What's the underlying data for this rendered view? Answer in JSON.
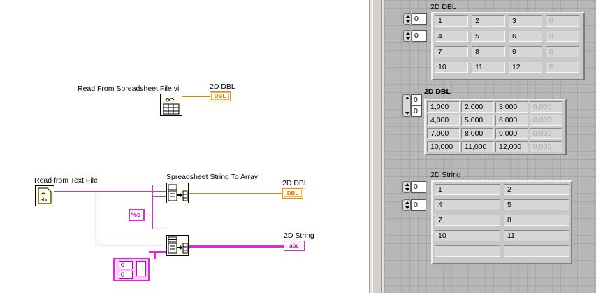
{
  "diagram": {
    "read_spreadsheet_label": "Read From Spreadsheet File.vi",
    "read_text_label": "Read from Text File",
    "spreadsheet_string_label": "Spreadsheet String To Array",
    "format_constant": "%s",
    "out_dbl_1_label": "2D DBL",
    "out_dbl_1_terminal": "DBL",
    "out_dbl_2_label": "2D DBL",
    "out_dbl_2_terminal": "DBL",
    "out_string_label": "2D String",
    "out_string_terminal": "abc",
    "read_text_icon": "abc",
    "array_constant": {
      "index_1": "0",
      "index_2": "0"
    }
  },
  "panel": {
    "arr1": {
      "label": "2D DBL",
      "index_row": "0",
      "index_col": "0",
      "rows": [
        [
          "1",
          "2",
          "3",
          "0"
        ],
        [
          "4",
          "5",
          "6",
          "0"
        ],
        [
          "7",
          "8",
          "9",
          "0"
        ],
        [
          "10",
          "11",
          "12",
          "0"
        ]
      ]
    },
    "arr2": {
      "label": "2D DBL",
      "index_row": "0",
      "index_col": "0",
      "rows": [
        [
          "1,000",
          "2,000",
          "3,000",
          "0,000"
        ],
        [
          "4,000",
          "5,000",
          "6,000",
          "0,000"
        ],
        [
          "7,000",
          "8,000",
          "9,000",
          "0,000"
        ],
        [
          "10,000",
          "11,000",
          "12,000",
          "0,000"
        ]
      ]
    },
    "arr3": {
      "label": "2D String",
      "index_row": "0",
      "index_col": "0",
      "rows": [
        [
          "1",
          "2"
        ],
        [
          "4",
          "5"
        ],
        [
          "7",
          "8"
        ],
        [
          "10",
          "11"
        ],
        [
          "",
          ""
        ]
      ]
    }
  }
}
